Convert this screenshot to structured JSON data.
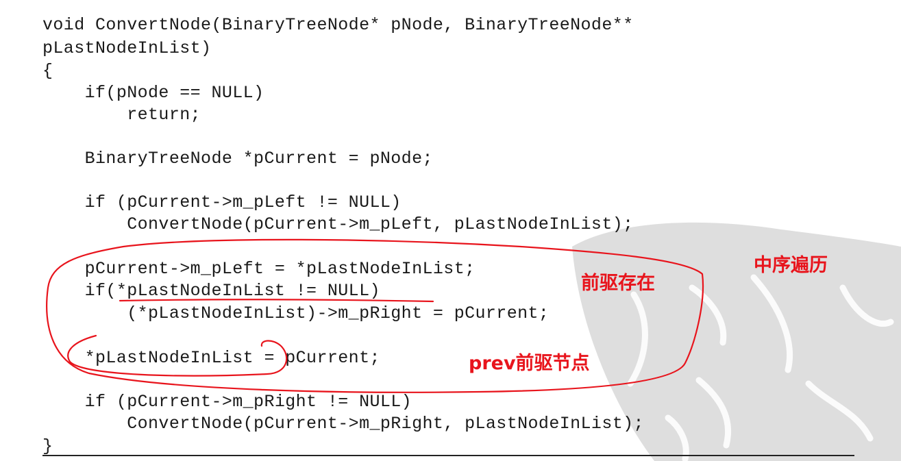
{
  "code": {
    "lines": [
      "void ConvertNode(BinaryTreeNode* pNode, BinaryTreeNode**",
      "pLastNodeInList)",
      "{",
      "    if(pNode == NULL)",
      "        return;",
      "    BinaryTreeNode *pCurrent = pNode;",
      "    if (pCurrent->m_pLeft != NULL)",
      "        ConvertNode(pCurrent->m_pLeft, pLastNodeInList);",
      "    pCurrent->m_pLeft = *pLastNodeInList;",
      "    if(*pLastNodeInList != NULL)",
      "        (*pLastNodeInList)->m_pRight = pCurrent;",
      "    *pLastNodeInList = pCurrent;",
      "    if (pCurrent->m_pRight != NULL)",
      "        ConvertNode(pCurrent->m_pRight, pLastNodeInList);",
      "}"
    ]
  },
  "annotations": {
    "inorder": "中序遍历",
    "prev_exists": "前驱存在",
    "prev_node": "prev前驱节点"
  },
  "colors": {
    "ink": "#e8141c",
    "text": "#1a1a1a",
    "watermark": "#dedede"
  }
}
